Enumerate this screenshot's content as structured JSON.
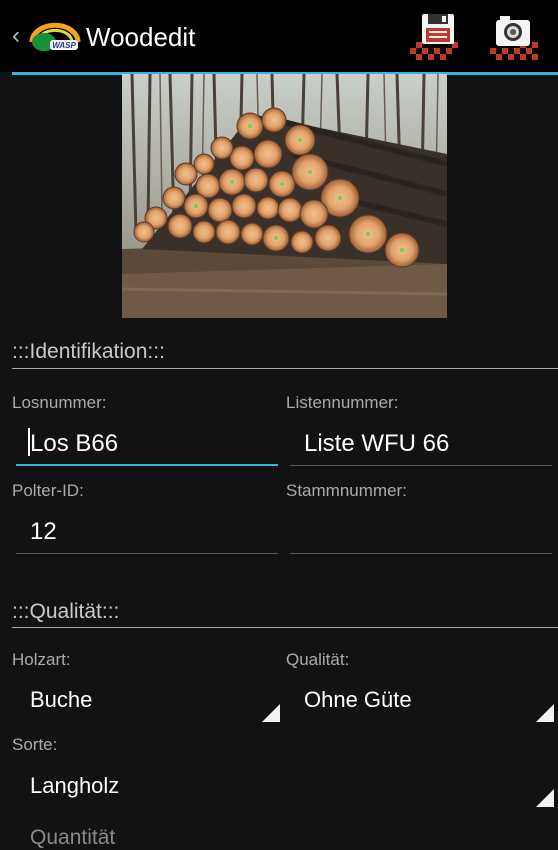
{
  "appbar": {
    "title": "Woodedit",
    "logo_text": "WASP"
  },
  "sections": {
    "identifikation": ":::Identifikation:::",
    "qualitaet": ":::Qualität:::",
    "next_partial": "Quantität"
  },
  "fields": {
    "losnummer": {
      "label": "Losnummer:",
      "value": "Los B66"
    },
    "listennummer": {
      "label": "Listennummer:",
      "value": "Liste WFU 66"
    },
    "polter_id": {
      "label": "Polter-ID:",
      "value": "12"
    },
    "stammnummer": {
      "label": "Stammnummer:",
      "value": ""
    },
    "holzart": {
      "label": "Holzart:",
      "value": "Buche"
    },
    "qualitaet": {
      "label": "Qualität:",
      "value": "Ohne Güte"
    },
    "sorte": {
      "label": "Sorte:",
      "value": "Langholz"
    }
  },
  "colors": {
    "accent": "#33b5e5",
    "background": "#111214"
  }
}
